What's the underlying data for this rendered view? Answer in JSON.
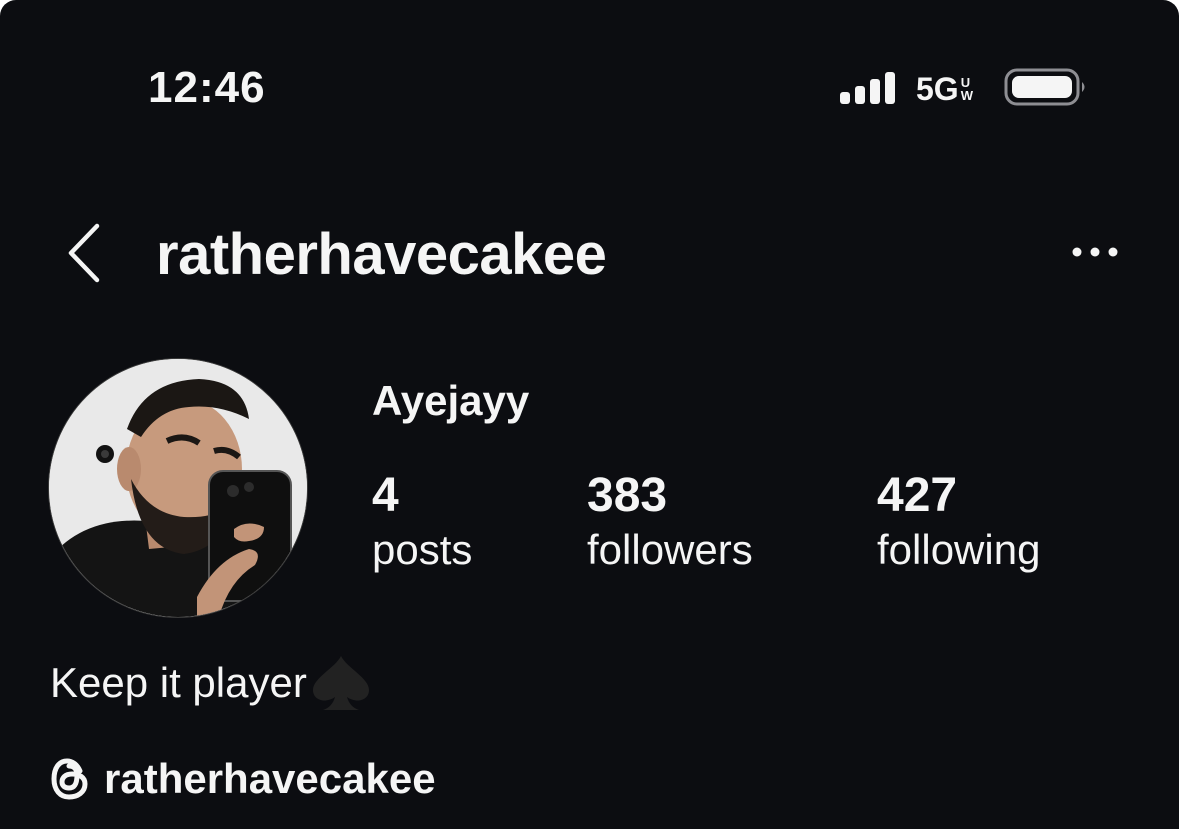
{
  "status_bar": {
    "time": "12:46",
    "network_main": "5G",
    "network_sup_1": "U",
    "network_sup_2": "W"
  },
  "header": {
    "username": "ratherhavecakee"
  },
  "profile": {
    "display_name": "Ayejayy",
    "stats": [
      {
        "value": "4",
        "label": "posts"
      },
      {
        "value": "383",
        "label": "followers"
      },
      {
        "value": "427",
        "label": "following"
      }
    ],
    "bio": "Keep it player",
    "threads_handle": "ratherhavecakee"
  },
  "colors": {
    "background": "#0c0d11",
    "text": "#f5f5f5"
  },
  "icons": [
    "signal-icon",
    "battery-icon",
    "back-chevron-icon",
    "more-options-icon",
    "spade-emoji",
    "threads-icon"
  ]
}
